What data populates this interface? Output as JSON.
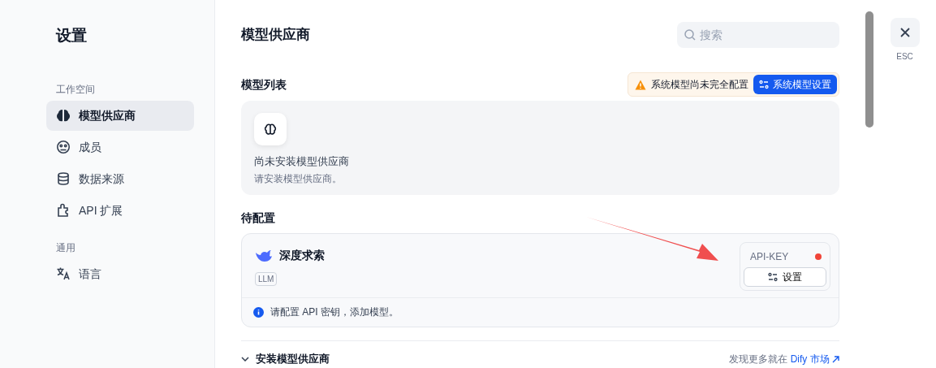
{
  "sidebar": {
    "title": "设置",
    "groups": [
      {
        "label": "工作空间",
        "items": [
          {
            "label": "模型供应商",
            "selected": true
          },
          {
            "label": "成员",
            "selected": false
          },
          {
            "label": "数据来源",
            "selected": false
          },
          {
            "label": "API 扩展",
            "selected": false
          }
        ]
      },
      {
        "label": "通用",
        "items": [
          {
            "label": "语言",
            "selected": false
          }
        ]
      }
    ]
  },
  "page": {
    "title": "模型供应商",
    "search": {
      "placeholder": "搜索"
    }
  },
  "model_list": {
    "title": "模型列表",
    "warning": "系统模型尚未完全配置",
    "settings_button": "系统模型设置",
    "empty_title": "尚未安装模型供应商",
    "empty_hint": "请安装模型供应商。"
  },
  "pending": {
    "title": "待配置",
    "providers": [
      {
        "name": "深度求索",
        "tags": [
          "LLM"
        ],
        "key_label": "API-KEY",
        "key_configured": false,
        "setup_button": "设置",
        "notice": "请配置 API 密钥，添加模型。"
      }
    ]
  },
  "install": {
    "title": "安装模型供应商",
    "expanded": true,
    "market_prefix": "发现更多就在",
    "market_link": "Dify 市场"
  },
  "close": {
    "hint": "ESC"
  }
}
